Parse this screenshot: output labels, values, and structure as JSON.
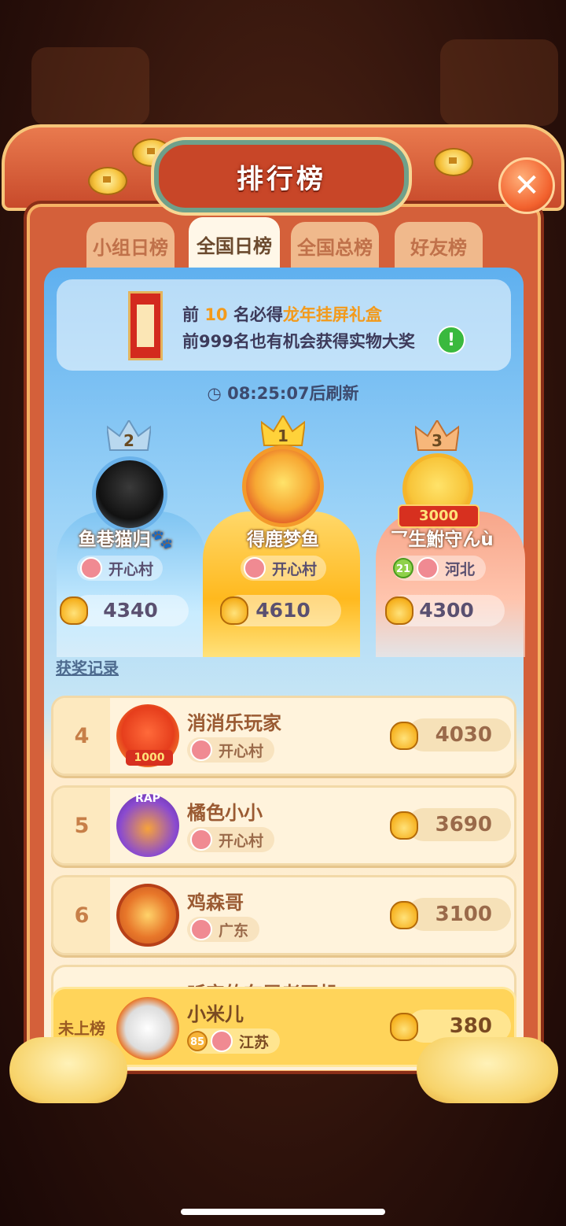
{
  "header": {
    "title": "排行榜",
    "close_label": "✕"
  },
  "tabs": [
    {
      "label": "小组日榜",
      "active": false
    },
    {
      "label": "全国日榜",
      "active": true
    },
    {
      "label": "全国总榜",
      "active": false
    },
    {
      "label": "好友榜",
      "active": false
    }
  ],
  "notice": {
    "line1_prefix": "前",
    "line1_number": "10",
    "line1_mid": "名必得",
    "line1_prize": "龙年挂屏礼盒",
    "line2": "前999名也有机会获得实物大奖",
    "info_icon": "!"
  },
  "refresh": {
    "time": "08:25:07",
    "suffix": "后刷新"
  },
  "podium": [
    {
      "rank": "2",
      "name": "鱼巷猫归🐾",
      "region": "开心村",
      "score": "4340"
    },
    {
      "rank": "1",
      "name": "得鹿梦鱼",
      "region": "开心村",
      "score": "4610"
    },
    {
      "rank": "3",
      "name": "乛生鮒守んù",
      "region": "河北",
      "level": "21",
      "frame_badge": "3000",
      "score": "4300"
    }
  ],
  "award_link": "获奖记录",
  "list": [
    {
      "rank": "4",
      "name": "消消乐玩家",
      "region": "开心村",
      "score": "4030",
      "frame_badge": "1000"
    },
    {
      "rank": "5",
      "name": "橘色小小",
      "region": "开心村",
      "score": "3690",
      "frame_badge": "RAP"
    },
    {
      "rank": "6",
      "name": "鸡森哥",
      "region": "广东",
      "score": "3100"
    }
  ],
  "partial_row_name": "听完的车属老司机",
  "self": {
    "rank_label": "未上榜",
    "name": "小米儿",
    "level": "85",
    "region": "江苏",
    "score": "380"
  },
  "colors": {
    "accent": "#f39a1b",
    "frame": "#d4603a",
    "self_row": "#ffd45a"
  }
}
